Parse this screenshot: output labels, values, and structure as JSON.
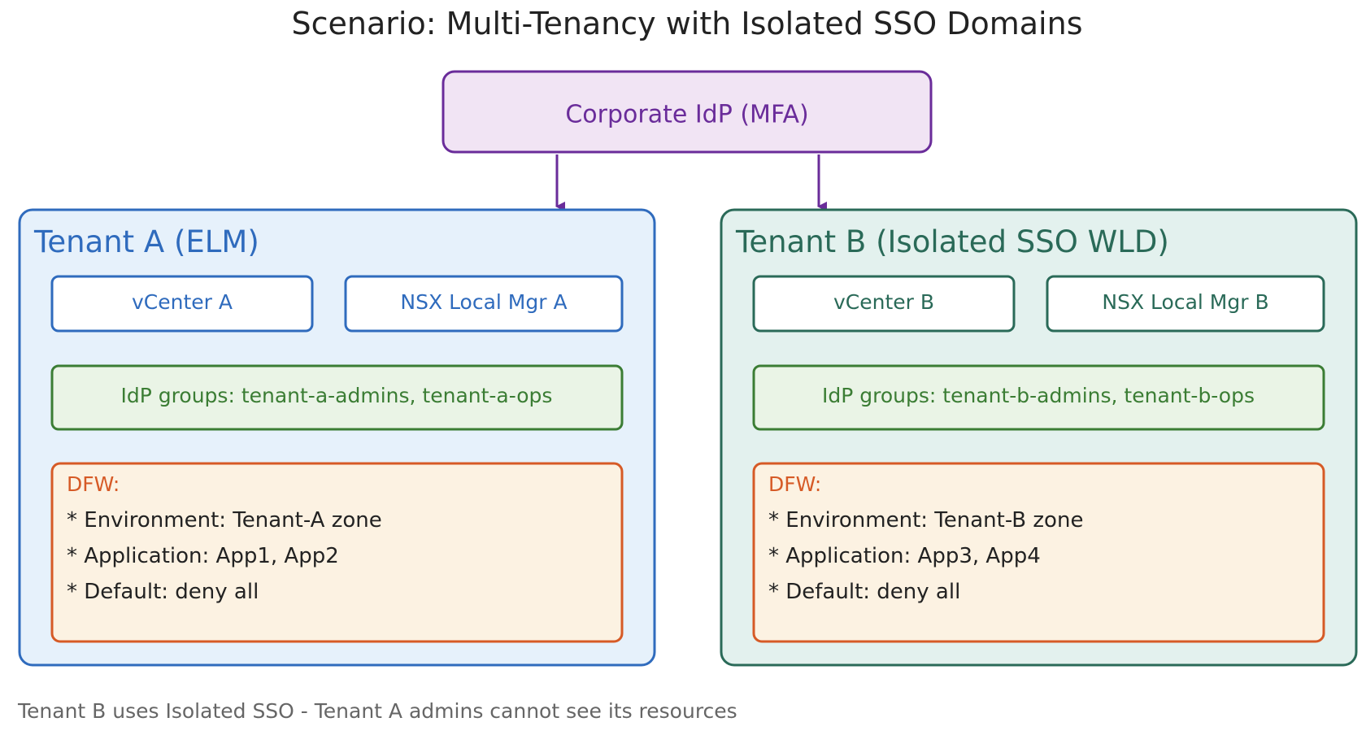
{
  "title": "Scenario: Multi-Tenancy with Isolated SSO Domains",
  "idp": {
    "label": "Corporate IdP (MFA)"
  },
  "tenant_a": {
    "title": "Tenant A (ELM)",
    "vcenter": "vCenter A",
    "nsx": "NSX Local Mgr A",
    "groups": "IdP groups: tenant-a-admins, tenant-a-ops",
    "dfw_title": "DFW:",
    "dfw_rules": [
      "* Environment: Tenant-A zone",
      "* Application: App1, App2",
      "* Default: deny all"
    ]
  },
  "tenant_b": {
    "title": "Tenant B (Isolated SSO WLD)",
    "vcenter": "vCenter B",
    "nsx": "NSX Local Mgr B",
    "groups": "IdP groups: tenant-b-admins, tenant-b-ops",
    "dfw_title": "DFW:",
    "dfw_rules": [
      "* Environment: Tenant-B zone",
      "* Application: App3, App4",
      "* Default: deny all"
    ]
  },
  "footer": "Tenant B uses Isolated SSO - Tenant A admins cannot see its resources",
  "colors": {
    "idp_stroke": "#6a2c9a",
    "idp_fill": "#f1e4f4",
    "tenant_a_stroke": "#2f6bbd",
    "tenant_a_fill": "#e6f1fb",
    "tenant_b_stroke": "#2a6a58",
    "tenant_b_fill": "#e3f1ee",
    "groups_stroke": "#3b7d34",
    "groups_fill": "#eaf4e6",
    "dfw_stroke": "#d65a26",
    "dfw_fill": "#fcf2e2",
    "text_dark": "#222222",
    "footer_text": "#666666"
  }
}
